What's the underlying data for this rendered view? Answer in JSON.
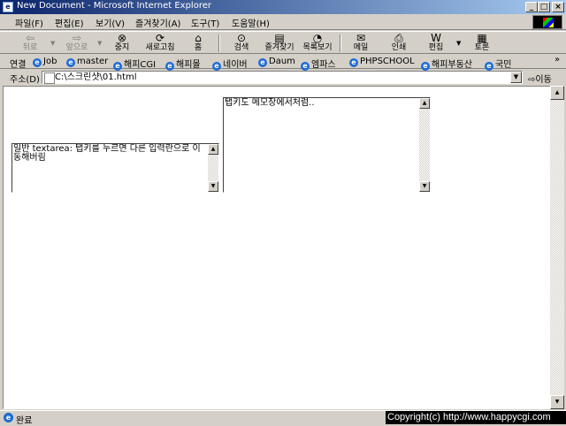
{
  "window": {
    "title": "New Document - Microsoft Internet Explorer",
    "minimize": "_",
    "maximize": "□",
    "close": "×"
  },
  "menu": [
    "파일(F)",
    "편집(E)",
    "보기(V)",
    "즐겨찾기(A)",
    "도구(T)",
    "도움말(H)"
  ],
  "toolbar": {
    "back": "뒤로",
    "forward": "앞으로",
    "stop": "중지",
    "refresh": "새로고침",
    "home": "홈",
    "search": "검색",
    "favorites": "즐겨찾기",
    "history": "목록보기",
    "mail": "메일",
    "print": "인쇄",
    "edit": "편집",
    "discuss": "토론"
  },
  "links": {
    "label": "연결",
    "items": [
      "Job",
      "master",
      "해피CGI",
      "해피몰",
      "네이버",
      "Daum",
      "엠파스",
      "PHPSCHOOL",
      "해피부동산",
      "국민"
    ],
    "more": "»"
  },
  "address": {
    "label": "주소(D)",
    "value": "C:\\스크린샷\\01.html",
    "go": "이동"
  },
  "content": {
    "textarea1": "일반 textarea: 탭키를 누르면 다른 입력란으로 이동해버림",
    "textarea2": "탭키도 메모장에서처럼.."
  },
  "status": {
    "text": "완료",
    "copyright": "Copyright(c) http://www.happycgi.com"
  },
  "icons": {
    "back": "back-arrow-icon",
    "forward": "forward-arrow-icon",
    "stop": "stop-icon",
    "refresh": "refresh-icon",
    "home": "home-icon",
    "search": "search-icon",
    "favorites": "favorites-folder-icon",
    "history": "history-icon",
    "mail": "mail-icon",
    "print": "printer-icon",
    "edit": "edit-icon",
    "discuss": "discuss-icon"
  },
  "colors": {
    "titlebar_start": "#0a246a",
    "titlebar_end": "#a6caf0",
    "chrome": "#d4d0c8"
  }
}
